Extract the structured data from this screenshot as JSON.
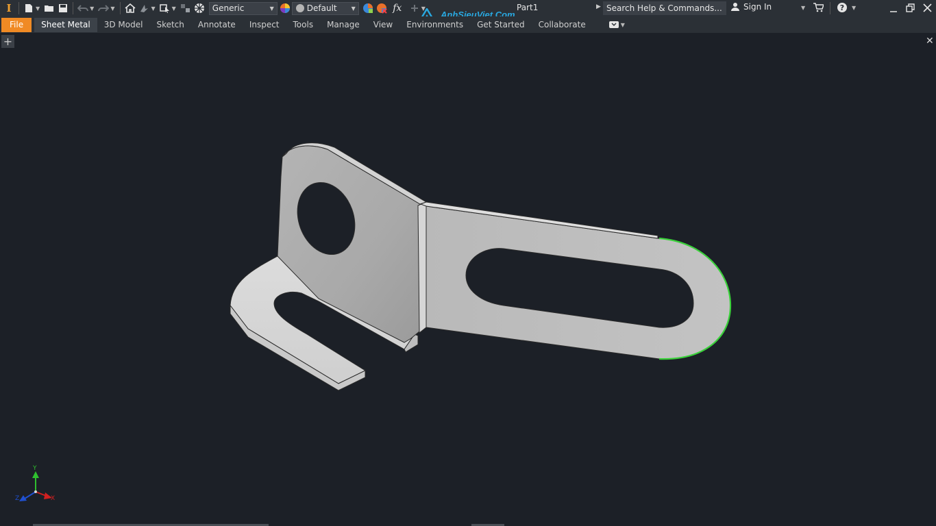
{
  "app": {
    "logo": "I",
    "document_title": "Part1"
  },
  "qat": {
    "material": "Generic",
    "appearance": "Default",
    "fx_label": "fx"
  },
  "search": {
    "placeholder": "Search Help & Commands..."
  },
  "account": {
    "sign_in": "Sign In"
  },
  "ribbon": {
    "tabs": [
      {
        "label": "File"
      },
      {
        "label": "Sheet Metal"
      },
      {
        "label": "3D Model"
      },
      {
        "label": "Sketch"
      },
      {
        "label": "Annotate"
      },
      {
        "label": "Inspect"
      },
      {
        "label": "Tools"
      },
      {
        "label": "Manage"
      },
      {
        "label": "View"
      },
      {
        "label": "Environments"
      },
      {
        "label": "Get Started"
      },
      {
        "label": "Collaborate"
      }
    ]
  },
  "watermark": {
    "text": "AnhSieuViet.Com"
  },
  "triad": {
    "x": "X",
    "y": "Y",
    "z": "Z"
  },
  "colors": {
    "background": "#1c2027",
    "toolbar": "#2b3036",
    "file_tab": "#f08a24",
    "highlight_edge": "#3ad13a",
    "part_face": "#bdbdbd"
  }
}
